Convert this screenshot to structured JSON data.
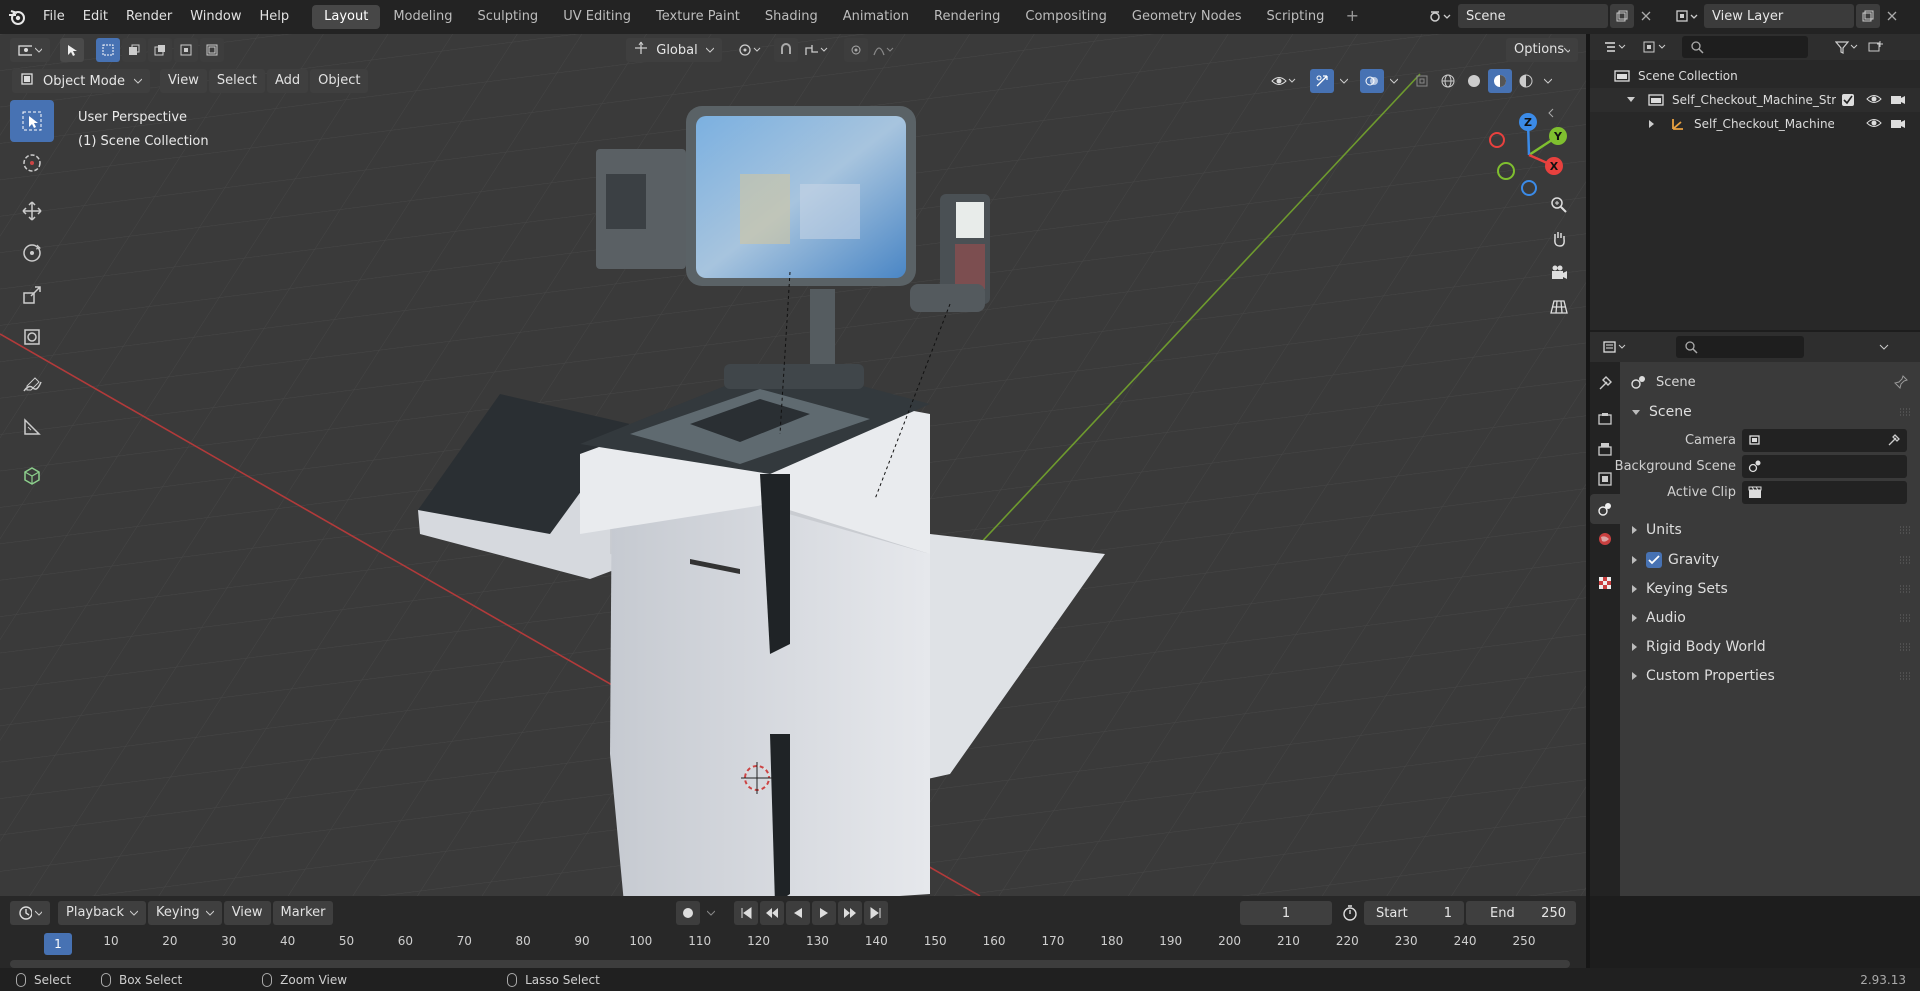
{
  "app": {
    "menu": [
      "File",
      "Edit",
      "Render",
      "Window",
      "Help"
    ],
    "workspaces": [
      "Layout",
      "Modeling",
      "Sculpting",
      "UV Editing",
      "Texture Paint",
      "Shading",
      "Animation",
      "Rendering",
      "Compositing",
      "Geometry Nodes",
      "Scripting"
    ],
    "active_workspace": "Layout",
    "scene_name": "Scene",
    "view_layer": "View Layer"
  },
  "viewport": {
    "orientation": "Global",
    "options_label": "Options",
    "mode": "Object Mode",
    "menus": [
      "View",
      "Select",
      "Add",
      "Object"
    ],
    "perspective": "User Perspective",
    "collection_label": "(1) Scene Collection",
    "gizmo": {
      "x": "X",
      "y": "Y",
      "z": "Z"
    }
  },
  "outliner": {
    "root": "Scene Collection",
    "items": [
      "Self_Checkout_Machine_Stror",
      "Self_Checkout_Machine_"
    ]
  },
  "properties": {
    "header": "Scene",
    "panel": "Scene",
    "fields": [
      {
        "label": "Camera"
      },
      {
        "label": "Background Scene"
      },
      {
        "label": "Active Clip"
      }
    ],
    "sections": [
      "Units",
      "Gravity",
      "Keying Sets",
      "Audio",
      "Rigid Body World",
      "Custom Properties"
    ],
    "gravity_checked": true
  },
  "timeline": {
    "menus": [
      "Playback",
      "Keying",
      "View",
      "Marker"
    ],
    "current_frame": "1",
    "start_label": "Start",
    "start": "1",
    "end_label": "End",
    "end": "250",
    "ticks": [
      "1",
      "10",
      "20",
      "30",
      "40",
      "50",
      "60",
      "70",
      "80",
      "90",
      "100",
      "110",
      "120",
      "130",
      "140",
      "150",
      "160",
      "170",
      "180",
      "190",
      "200",
      "210",
      "220",
      "230",
      "240",
      "250"
    ]
  },
  "status": {
    "items": [
      "Select",
      "Box Select",
      "Zoom View",
      "Lasso Select"
    ],
    "version": "2.93.13"
  },
  "colors": {
    "accent": "#4772b3",
    "x_axis": "#e8413e",
    "y_axis": "#7fbf2f",
    "z_axis": "#3b8be8"
  }
}
